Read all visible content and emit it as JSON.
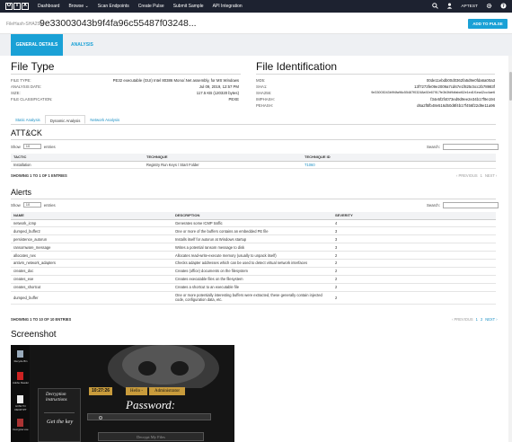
{
  "nav": {
    "logo": [
      "O",
      "T",
      "X"
    ],
    "links": [
      "Dashboard",
      "Browse",
      "Scan Endpoints",
      "Create Pulse",
      "Submit Sample",
      "API Integration"
    ],
    "browse_caret": "⌄",
    "user": "APTEST"
  },
  "header": {
    "label": "FileHash-SHA256:",
    "hash": "9e33003043b9f4fa96c55487f03248...",
    "add_button": "ADD TO PULSE"
  },
  "tabs": [
    "GENERAL DETAILS",
    "ANALYSIS"
  ],
  "file_type": {
    "title": "File Type",
    "rows": [
      {
        "label": "FILE TYPE:",
        "value": "PE32 executable (GUI) Intel 80386 Mono/.Net assembly, for MS Windows"
      },
      {
        "label": "ANALYSIS DATE:",
        "value": "Jul 09, 2019, 12:57 PM"
      },
      {
        "label": "SIZE:",
        "value": "117.5 KB (120320 bytes)"
      },
      {
        "label": "FILE CLASSIFICATION:",
        "value": "PEXE"
      }
    ]
  },
  "file_id": {
    "title": "File Identification",
    "rows": [
      {
        "label": "MD5:",
        "value": "00de11ebdb00d0362fa5d9e0fda6a00a3"
      },
      {
        "label": "SHA1:",
        "value": "13f7273fe09e2009a7cd67e1f825c5cc2b78983f"
      },
      {
        "label": "SHA256:",
        "value": "9e33003043b9f4fa96c55487f03248a92e67917fe3b3fd9dfabd62e1ed1f1ea42cc4ae6"
      },
      {
        "label": "IMPHASH:",
        "value": "f34e5f2f4073ed9d9ee2e34b17f9e194"
      },
      {
        "label": "PEHASH:",
        "value": "d6a2f5fb48e516d50d8f4b17f456f22d9e11a96"
      }
    ]
  },
  "subtabs": [
    "Static Analysis",
    "Dynamic Analysis",
    "Network Analysis"
  ],
  "attck": {
    "title": "ATT&CK",
    "show_label": "Show",
    "entries_label": "entries",
    "page_size": "10",
    "search_label": "Search:",
    "columns": [
      "TACTIC",
      "TECHNIQUE",
      "TECHNIQUE ID"
    ],
    "rows": [
      [
        "Installation",
        "Registry Run Keys / Start Folder",
        "T1060"
      ]
    ],
    "footer": "SHOWING 1 TO 1 OF 1 ENTRIES",
    "prev": "‹ PREVIOUS",
    "page": "1",
    "next": "NEXT ›"
  },
  "alerts": {
    "title": "Alerts",
    "show_label": "Show",
    "entries_label": "entries",
    "page_size": "10",
    "search_label": "Search:",
    "columns": [
      "NAME",
      "DESCRIPTION",
      "SEVERITY"
    ],
    "rows": [
      [
        "network_icmp",
        "Generates some ICMP traffic",
        "4"
      ],
      [
        "dumped_buffer2",
        "One or more of the buffers contains an embedded PE file",
        "3"
      ],
      [
        "persistence_autorun",
        "Installs itself for autorun at Windows startup",
        "3"
      ],
      [
        "ransomware_message",
        "Writes a potential ransom message to disk",
        "3"
      ],
      [
        "allocates_rwx",
        "Allocates read-write-execute memory (usually to unpack itself)",
        "2"
      ],
      [
        "antivm_network_adapters",
        "Checks adapter addresses which can be used to detect virtual network interfaces",
        "2"
      ],
      [
        "creates_doc",
        "Creates (office) documents on the filesystem",
        "2"
      ],
      [
        "creates_exe",
        "Creates executable files on the filesystem",
        "2"
      ],
      [
        "creates_shortcut",
        "Creates a shortcut to an executable file",
        "2"
      ],
      [
        "dumped_buffer",
        "One or more potentially interesting buffers were extracted, these generally contain injected code, configuration data, etc.",
        "2"
      ]
    ],
    "footer": "SHOWING 1 TO 10 OF 10 ENTRIES",
    "prev": "‹ PREVIOUS",
    "pages": [
      "1",
      "2"
    ],
    "next": "NEXT ›"
  },
  "screenshot": {
    "title": "Screenshot",
    "desktop_icons": [
      "Recycle Bin",
      "Adobe Reader",
      "HOW TO DECRYPT",
      "Decrypter.exe"
    ],
    "decryption": "Decryption instructions",
    "get_key": "Get the key",
    "time": "10:27:26",
    "hello": "Hello -",
    "user": "Administrator",
    "password": "Password:",
    "decrypt_button": "Decrypt My Files"
  },
  "colors": {
    "accent": "#1aa1d6",
    "nav": "#1d2230",
    "gold": "#c89b3c"
  }
}
